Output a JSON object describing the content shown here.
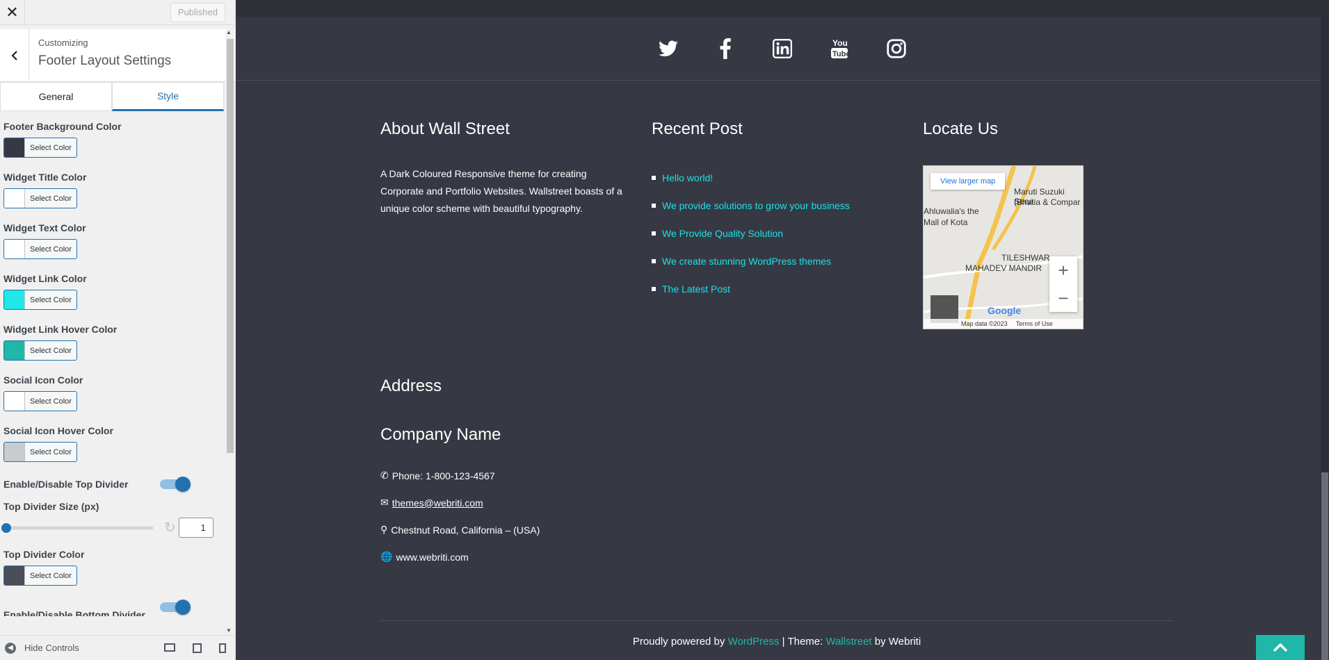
{
  "sidebar": {
    "close_label": "✕",
    "published_label": "Published",
    "back_label": "‹",
    "crumb": "Customizing",
    "title": "Footer Layout Settings",
    "tabs": [
      "General",
      "Style"
    ],
    "controls": {
      "footer_bg": {
        "label": "Footer Background Color",
        "button": "Select Color",
        "color": "#363943"
      },
      "widget_title": {
        "label": "Widget Title Color",
        "button": "Select Color",
        "color": "#ffffff"
      },
      "widget_text": {
        "label": "Widget Text Color",
        "button": "Select Color",
        "color": "#ffffff"
      },
      "widget_link": {
        "label": "Widget Link Color",
        "button": "Select Color",
        "color": "#1fe8e6"
      },
      "widget_link_hover": {
        "label": "Widget Link Hover Color",
        "button": "Select Color",
        "color": "#1fb7a8"
      },
      "social_icon": {
        "label": "Social Icon Color",
        "button": "Select Color",
        "color": "#ffffff"
      },
      "social_icon_hover": {
        "label": "Social Icon Hover Color",
        "button": "Select Color",
        "color": "#c9cbce"
      },
      "top_divider_toggle": {
        "label": "Enable/Disable Top Divider"
      },
      "top_divider_size": {
        "label": "Top Divider Size (px)",
        "value": "1"
      },
      "top_divider_color": {
        "label": "Top Divider Color",
        "button": "Select Color",
        "color": "#4a4e58"
      },
      "bottom_divider_toggle": {
        "label": "Enable/Disable Bottom Divider"
      }
    },
    "hide_controls": "Hide Controls"
  },
  "footer": {
    "about": {
      "title": "About Wall Street",
      "text": "A Dark Coloured Responsive theme for creating Corporate and Portfolio Websites. Wallstreet boasts of a unique color scheme with beautiful typography."
    },
    "recent": {
      "title": "Recent Post",
      "posts": [
        "Hello world!",
        "We provide solutions to grow your business",
        "We Provide Quality Solution",
        "We create stunning WordPress themes",
        "The Latest Post"
      ]
    },
    "locate": {
      "title": "Locate Us",
      "map_link": "View larger map",
      "map_labels": [
        "Maruti Suzuki Servi",
        "(Bhatia & Compar",
        "Ahluwalia's the",
        "Mall of Kota",
        "TILESHWAR",
        "MAHADEV MANDIR"
      ],
      "map_data": "Map data ©2023",
      "terms": "Terms of Use",
      "google": "Google"
    },
    "address": {
      "title": "Address",
      "company": "Company Name",
      "phone": "Phone: 1-800-123-4567",
      "email": "themes@webriti.com",
      "location": "Chestnut Road, California – (USA)",
      "website": "www.webriti.com"
    },
    "credits": {
      "prefix": "Proudly powered by ",
      "wp": "WordPress",
      "middle": " | Theme: ",
      "theme": "Wallstreet",
      "suffix": " by Webriti"
    },
    "social_icons": [
      "twitter-icon",
      "facebook-icon",
      "linkedin-icon",
      "youtube-icon",
      "instagram-icon"
    ]
  }
}
